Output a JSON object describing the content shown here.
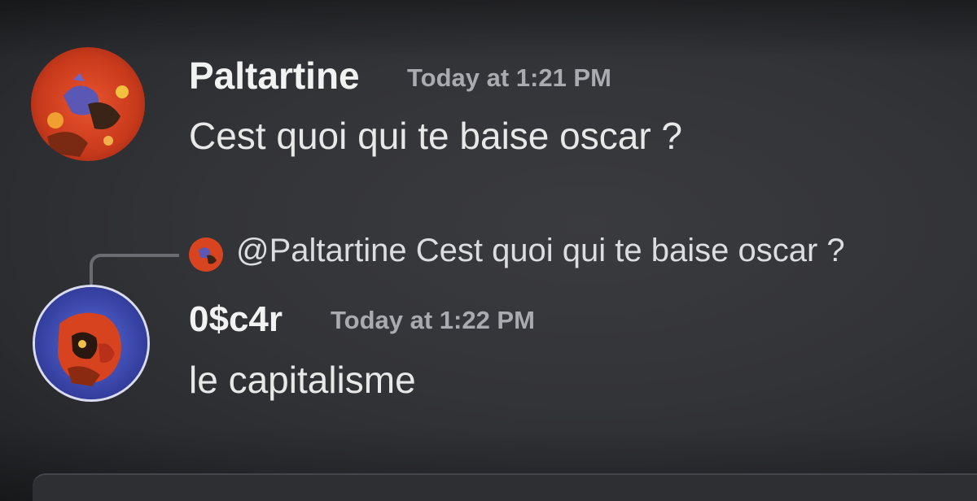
{
  "messages": [
    {
      "username": "Paltartine",
      "timestamp": "Today at 1:21 PM",
      "content": "Cest quoi qui te baise oscar ?",
      "avatar_icon": "paltartine-avatar"
    },
    {
      "reply": {
        "mention": "@Paltartine Cest quoi qui te baise oscar ?",
        "avatar_icon": "paltartine-avatar"
      },
      "username": "0$c4r",
      "timestamp": "Today at 1:22 PM",
      "content": "le capitalisme",
      "avatar_icon": "oscar-avatar"
    }
  ],
  "colors": {
    "background": "#333438",
    "username": "#f2f2f2",
    "timestamp": "#a9abb0",
    "text": "#e8e8e8",
    "reply_spine": "#6a6c71"
  }
}
